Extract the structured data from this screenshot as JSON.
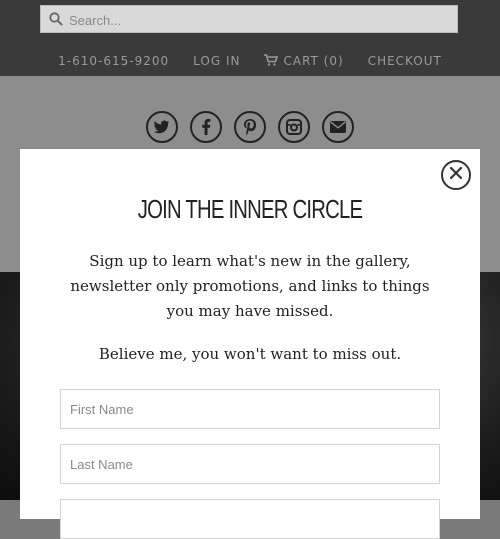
{
  "search": {
    "placeholder": "Search..."
  },
  "nav": {
    "phone": "1-610-615-9200",
    "login": "LOG IN",
    "cart": "CART (0)",
    "checkout": "CHECKOUT"
  },
  "social": [
    "twitter-icon",
    "facebook-icon",
    "pinterest-icon",
    "instagram-icon",
    "mail-icon"
  ],
  "modal": {
    "title": "JOIN THE INNER CIRCLE",
    "description": "Sign up to learn what's new in the gallery, newsletter only promotions, and links to things you may have missed.",
    "tagline": "Believe me, you won't want to miss out.",
    "first_name_placeholder": "First Name",
    "last_name_placeholder": "Last Name",
    "email_placeholder": ""
  },
  "colors": {
    "topbar": "#3a3a3a",
    "overlay": "#8d8d8d",
    "modal_bg": "#ffffff"
  }
}
